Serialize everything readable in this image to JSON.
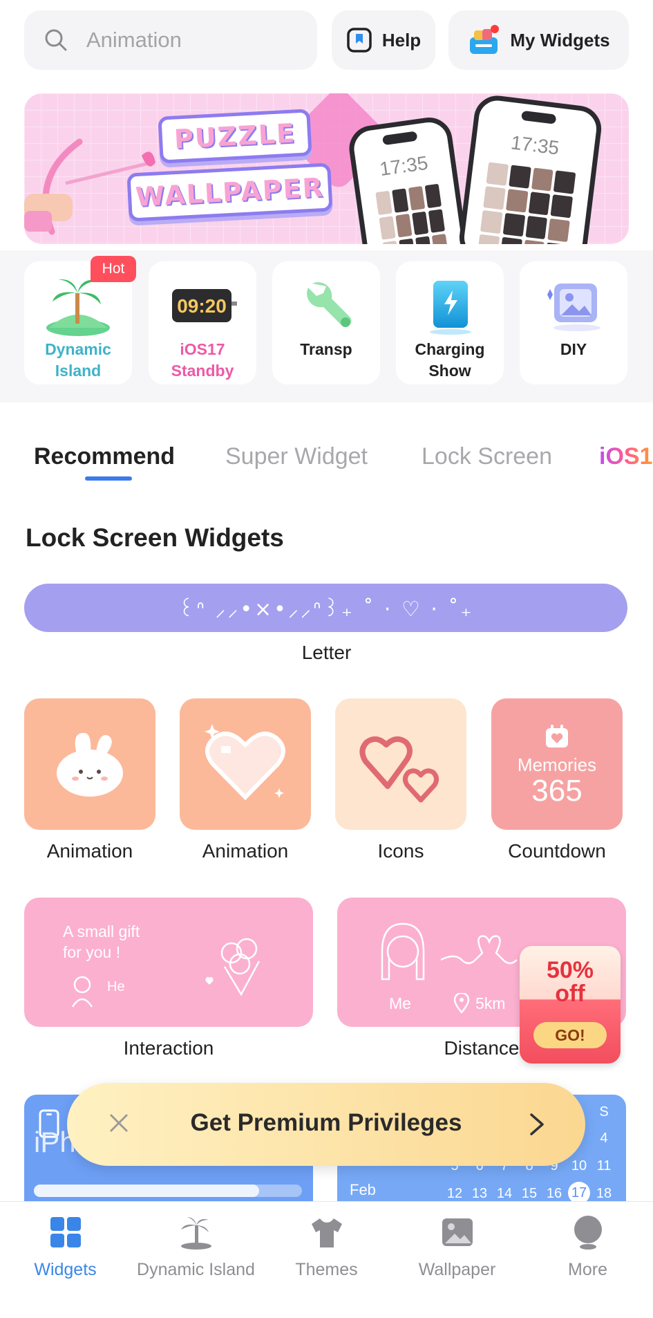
{
  "search": {
    "placeholder": "Animation",
    "icon": "search-icon"
  },
  "header": {
    "help_label": "Help",
    "my_widgets_label": "My Widgets"
  },
  "banner": {
    "line1": "PUZZLE",
    "line2": "WALLPAPER",
    "time1": "17:35",
    "time2": "17:35"
  },
  "categories": [
    {
      "label": "Dynamic\nIsland",
      "color": "#3fb2c9",
      "icon": "palm-island-icon",
      "badge": "Hot"
    },
    {
      "label": "iOS17\nStandby",
      "color": "#ec5aa6",
      "icon": "standby-clock-icon",
      "clock": "09:20"
    },
    {
      "label": "Transp",
      "color": "#222222",
      "icon": "wrench-icon"
    },
    {
      "label": "Charging\nShow",
      "color": "#222222",
      "icon": "charging-phone-icon"
    },
    {
      "label": "DIY",
      "color": "#222222",
      "icon": "diy-image-icon"
    }
  ],
  "tabs": [
    {
      "label": "Recommend",
      "active": true
    },
    {
      "label": "Super Widget"
    },
    {
      "label": "Lock Screen"
    },
    {
      "label": "iOS1"
    }
  ],
  "section": {
    "title": "Lock Screen Widgets",
    "letter_art": "꒰ᐢ ⸝⸝•×•⸝⸝ᐢ꒱₊ ˚ · ♡ · ˚₊",
    "letter_label": "Letter",
    "tiles": [
      {
        "label": "Animation",
        "bg": "#fbb99a"
      },
      {
        "label": "Animation",
        "bg": "#fbb99a"
      },
      {
        "label": "Icons",
        "bg": "#fde5cf"
      },
      {
        "label": "Countdown",
        "bg": "#f7a2a2",
        "line1": "Memories",
        "line2": "365"
      }
    ],
    "wide": [
      {
        "label": "Interaction",
        "line1": "A small gift",
        "line2": "for you !",
        "sender": "He"
      },
      {
        "label": "Distance",
        "me": "Me",
        "km": "5km"
      }
    ],
    "bottom_cards": {
      "iphone": "iPhone",
      "battery_level": 0.84,
      "calendar_month": "Feb",
      "calendar_rows": [
        [
          "S"
        ],
        [
          "4"
        ],
        [
          "5",
          "6",
          "7",
          "8",
          "9",
          "10",
          "11"
        ],
        [
          "12",
          "13",
          "14",
          "15",
          "16",
          "17",
          "18"
        ]
      ],
      "calendar_today": "17"
    }
  },
  "promo": {
    "pct": "50%",
    "off": "off",
    "go": "GO!"
  },
  "premium": {
    "label": "Get Premium Privileges"
  },
  "nav": [
    {
      "label": "Widgets",
      "active": true,
      "icon": "widgets-grid-icon"
    },
    {
      "label": "Dynamic Island",
      "icon": "palm-tree-icon"
    },
    {
      "label": "Themes",
      "icon": "tshirt-icon"
    },
    {
      "label": "Wallpaper",
      "icon": "picture-icon"
    },
    {
      "label": "More",
      "icon": "more-circle-icon"
    }
  ]
}
